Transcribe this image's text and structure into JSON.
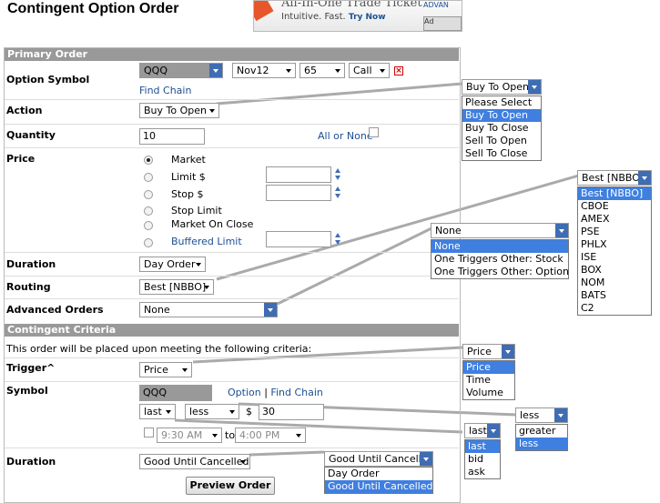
{
  "header": {
    "title": "Contingent Option Order"
  },
  "banner": {
    "line1": "All-In-One Trade Ticket",
    "line2": "Intuitive. Fast.",
    "cta": "Try Now",
    "ad1": "ADVAN",
    "ad2": "Ad"
  },
  "primary": {
    "section": "Primary Order",
    "option_symbol_label": "Option Symbol",
    "symbol": "QQQ",
    "expiry": "Nov12",
    "strike": "65",
    "type": "Call",
    "find_chain": "Find Chain",
    "action_label": "Action",
    "action": "Buy To Open",
    "quantity_label": "Quantity",
    "quantity": "10",
    "all_or_none": "All or None",
    "price_label": "Price",
    "price_options": [
      "Market",
      "Limit $",
      "Stop $",
      "Stop Limit",
      "Market On Close",
      "Buffered Limit"
    ],
    "duration_label": "Duration",
    "duration": "Day Order",
    "routing_label": "Routing",
    "routing": "Best [NBBO]",
    "advanced_label": "Advanced Orders",
    "advanced": "None"
  },
  "contingent": {
    "section": "Contingent Criteria",
    "note": "This order will be placed upon meeting the following criteria:",
    "trigger_label": "Trigger^",
    "trigger": "Price",
    "symbol_label": "Symbol",
    "symbol": "QQQ",
    "option_link": "Option",
    "find_chain": "Find Chain",
    "field": "last",
    "operator": "less",
    "currency": "$",
    "value": "30",
    "time_from": "9:30 AM",
    "to": "to",
    "time_to": "4:00 PM",
    "duration_label": "Duration",
    "duration": "Good Until Cancelled",
    "preview": "Preview Order"
  },
  "callouts": {
    "action": {
      "selected": "Buy To Open",
      "options": [
        "Please Select",
        "Buy To Open",
        "Buy To Close",
        "Sell To Open",
        "Sell To Close"
      ]
    },
    "routing": {
      "selected": "Best [NBBO]",
      "options": [
        "Best [NBBO]",
        "CBOE",
        "AMEX",
        "PSE",
        "PHLX",
        "ISE",
        "BOX",
        "NOM",
        "BATS",
        "C2"
      ]
    },
    "advanced": {
      "selected": "None",
      "options": [
        "None",
        "One Triggers Other: Stock",
        "One Triggers Other: Option"
      ]
    },
    "trigger": {
      "selected": "Price",
      "options": [
        "Price",
        "Time",
        "Volume"
      ]
    },
    "operator": {
      "selected": "less",
      "options": [
        "greater",
        "less"
      ]
    },
    "field": {
      "selected": "last",
      "options": [
        "last",
        "bid",
        "ask"
      ]
    },
    "duration": {
      "selected": "Good Until Cancelled",
      "options": [
        "Day Order",
        "Good Until Cancelled"
      ]
    }
  }
}
